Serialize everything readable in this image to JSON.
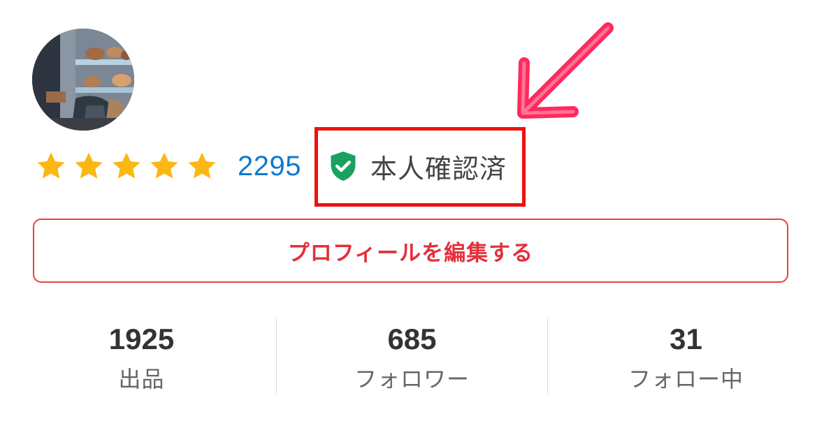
{
  "profile": {
    "rating": {
      "stars": 5,
      "review_count": "2295"
    },
    "verified_label": "本人確認済",
    "edit_button_label": "プロフィールを編集する"
  },
  "stats": [
    {
      "value": "1925",
      "label": "出品"
    },
    {
      "value": "685",
      "label": "フォロワー"
    },
    {
      "value": "31",
      "label": "フォロー中"
    }
  ],
  "icons": {
    "star": "star-icon",
    "verified": "shield-check-icon",
    "annotation": "pointing-arrow"
  },
  "colors": {
    "star": "#fbb713",
    "link": "#0a7bd2",
    "verified_green": "#1aa15e",
    "accent_red": "#e3303a",
    "annotation_red": "#ee1111",
    "annotation_pink": "#ff2a5f"
  }
}
